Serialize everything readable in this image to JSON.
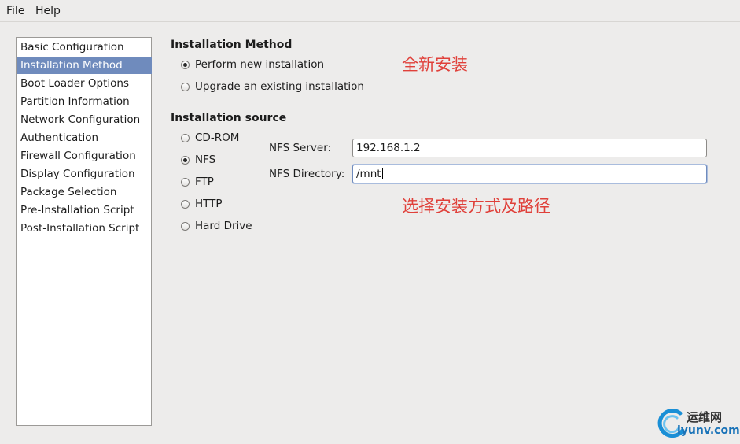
{
  "menubar": {
    "file": "File",
    "help": "Help"
  },
  "sidebar": {
    "items": [
      {
        "label": "Basic Configuration"
      },
      {
        "label": "Installation Method"
      },
      {
        "label": "Boot Loader Options"
      },
      {
        "label": "Partition Information"
      },
      {
        "label": "Network Configuration"
      },
      {
        "label": "Authentication"
      },
      {
        "label": "Firewall Configuration"
      },
      {
        "label": "Display Configuration"
      },
      {
        "label": "Package Selection"
      },
      {
        "label": "Pre-Installation Script"
      },
      {
        "label": "Post-Installation Script"
      }
    ],
    "selected": "Installation Method"
  },
  "installation_method": {
    "heading": "Installation Method",
    "options": [
      {
        "label": "Perform new installation",
        "checked": true
      },
      {
        "label": "Upgrade an existing installation",
        "checked": false
      }
    ]
  },
  "installation_source": {
    "heading": "Installation source",
    "options": [
      {
        "label": "CD-ROM",
        "checked": false
      },
      {
        "label": "NFS",
        "checked": true
      },
      {
        "label": "FTP",
        "checked": false
      },
      {
        "label": "HTTP",
        "checked": false
      },
      {
        "label": "Hard Drive",
        "checked": false
      }
    ],
    "nfs_server_label": "NFS Server:",
    "nfs_server_value": "192.168.1.2",
    "nfs_directory_label": "NFS Directory:",
    "nfs_directory_value": "/mnt"
  },
  "annotations": {
    "new_install": "全新安装",
    "choose_method": "选择安装方式及路径"
  },
  "watermark": {
    "name_cn": "运维网",
    "url": "iyunv.com"
  },
  "colors": {
    "selection": "#6f8bbd",
    "annotation": "#e0403a",
    "background": "#edeceb"
  }
}
